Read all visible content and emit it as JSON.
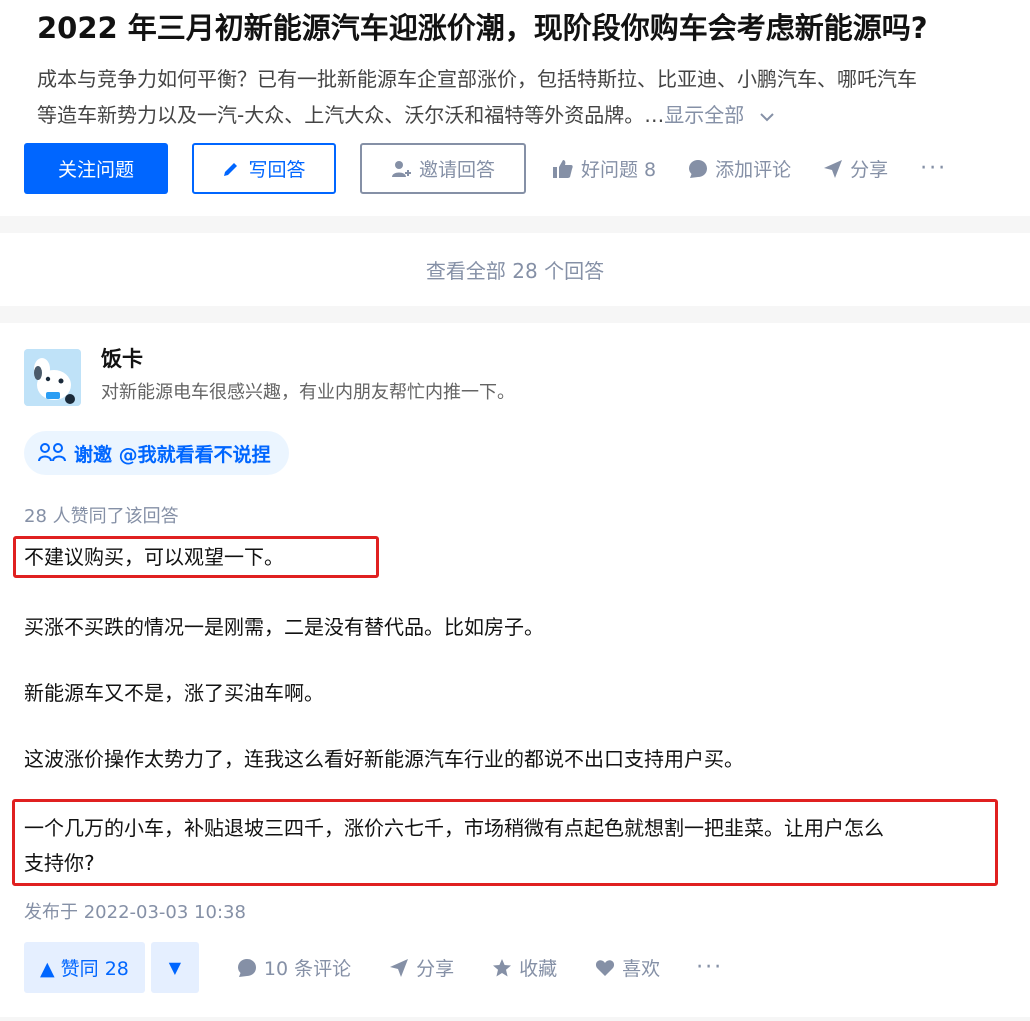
{
  "question": {
    "title": "2022 年三月初新能源汽车迎涨价潮，现阶段你购车会考虑新能源吗?",
    "desc_line1": "成本与竞争力如何平衡？已有一批新能源车企宣部涨价，包括特斯拉、比亚迪、小鹏汽车、哪吒汽车",
    "desc_line2": "等造车新势力以及一汽-大众、上汽大众、沃尔沃和福特等外资品牌。…",
    "show_all": "显示全部",
    "actions": {
      "follow": "关注问题",
      "write": "写回答",
      "invite": "邀请回答",
      "good_question": "好问题 8",
      "comment": "添加评论",
      "share": "分享",
      "more": "···"
    }
  },
  "view_all_answers": "查看全部 28 个回答",
  "answer": {
    "author": "饭卡",
    "bio": "对新能源电车很感兴趣，有业内朋友帮忙内推一下。",
    "invite_tag": "谢邀 @我就看看不说捏",
    "voters": "28 人赞同了该回答",
    "paragraphs": [
      "不建议购买，可以观望一下。",
      "买涨不买跌的情况一是刚需，二是没有替代品。比如房子。",
      "新能源车又不是，涨了买油车啊。",
      "这波涨价操作太势力了，连我这么看好新能源汽车行业的都说不出口支持用户买。",
      "一个几万的小车，补贴退坡三四千，涨价六七千，市场稍微有点起色就想割一把韭菜。让用户怎么",
      "支持你?"
    ],
    "published": "发布于 2022-03-03 10:38",
    "actions": {
      "upvote": "▲ 赞同 28",
      "downvote": "▼",
      "comments": "10 条评论",
      "share": "分享",
      "collect": "收藏",
      "like": "喜欢",
      "more": "···"
    }
  },
  "colors": {
    "brand_blue": "#0066ff",
    "muted_gray": "#8590a6",
    "highlight_red": "#e02020"
  }
}
